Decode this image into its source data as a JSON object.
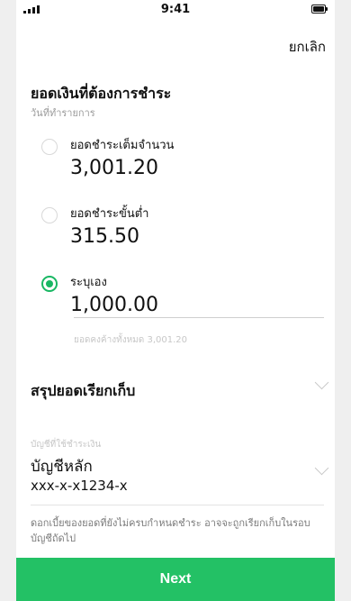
{
  "status_bar": {
    "time": "9:41",
    "signal_icon": "signal-icon",
    "battery_icon": "battery-icon"
  },
  "header": {
    "cancel_label": "ยกเลิก"
  },
  "payment_amount": {
    "title": "ยอดเงินที่ต้องการชำระ",
    "subtitle": "วันที่ทำรายการ",
    "options": [
      {
        "label": "ยอดชำระเต็มจำนวน",
        "value": "3,001.20",
        "selected": false
      },
      {
        "label": "ยอดชำระขั้นต่ำ",
        "value": "315.50",
        "selected": false
      },
      {
        "label": "ระบุเอง",
        "value": "1,000.00",
        "selected": true
      }
    ],
    "custom_hint": "ยอดคงค้างทั้งหมด 3,001.20"
  },
  "summary": {
    "title": "สรุปยอดเรียกเก็บ"
  },
  "account": {
    "label": "บัญชีที่ใช้ชำระเงิน",
    "name": "บัญชีหลัก",
    "number": "xxx-x-x1234-x"
  },
  "note": "ดอกเบี้ยของยอดที่ยังไม่ครบกำหนดชำระ อาจจะถูกเรียกเก็บในรอบบัญชีถัดไป",
  "footer": {
    "next_label": "Next"
  },
  "colors": {
    "accent": "#23c165",
    "radio_selected": "#19b763",
    "sidebar": "#efefef"
  }
}
